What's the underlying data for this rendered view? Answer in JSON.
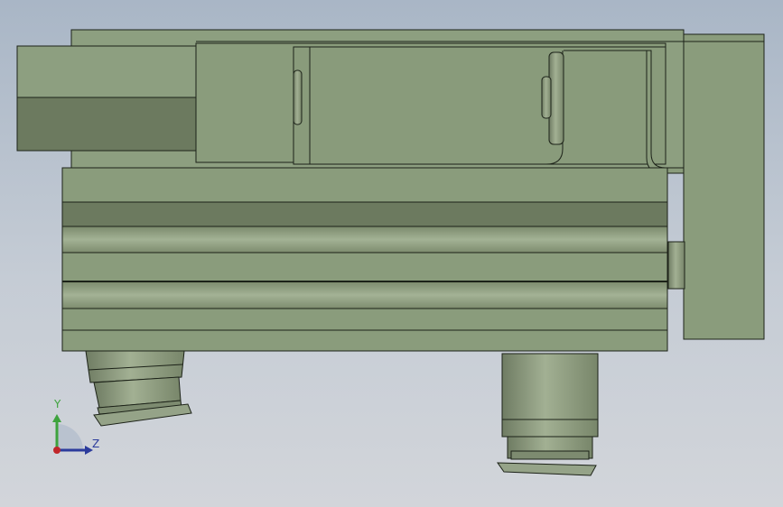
{
  "viewport": {
    "colors": {
      "body": "#8a9c7c",
      "body_dark": "#6c7a5f",
      "body_light": "#9dac8e",
      "edge": "#1c2218"
    }
  },
  "triad": {
    "y_label": "Y",
    "z_label": "Z",
    "colors": {
      "y": "#3ea33e",
      "z": "#2b3b9c",
      "origin": "#c0262b"
    }
  }
}
